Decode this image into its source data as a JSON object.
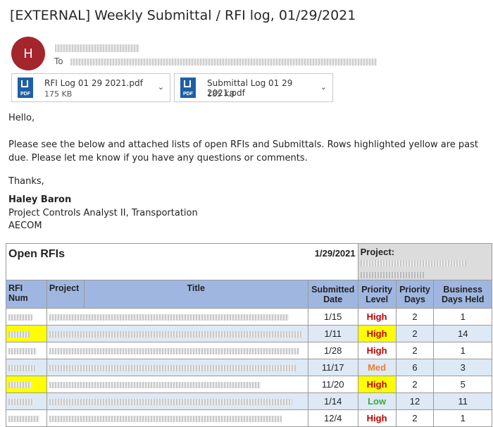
{
  "email": {
    "subject": "[EXTERNAL] Weekly Submittal / RFI log, 01/29/2021",
    "avatar_initial": "H",
    "to_label": "To",
    "attachments": [
      {
        "name": "RFI Log 01 29 2021.pdf",
        "size": "175 KB",
        "icon": "pdf-file-icon"
      },
      {
        "name": "Submittal Log 01 29 2021.pdf",
        "size": "185 KB",
        "icon": "pdf-file-icon"
      }
    ],
    "greeting": "Hello,",
    "paragraph": "Please see the below and attached lists of open RFIs and Submittals. Rows highlighted yellow are past due. Please let me know if you have any questions or comments.",
    "closing": "Thanks,",
    "signature": {
      "name": "Haley Baron",
      "title": "Project Controls Analyst II, Transportation",
      "company": "AECOM"
    }
  },
  "table": {
    "title": "Open RFIs",
    "date": "1/29/2021",
    "project_label": "Project:",
    "columns": [
      "RFI Num",
      "Project",
      "Title",
      "Submitted Date",
      "Priority Level",
      "Priority Days",
      "Business Days Held"
    ],
    "rows": [
      {
        "submitted": "1/15",
        "priority": "High",
        "days": "2",
        "held": "1",
        "past_due": false
      },
      {
        "submitted": "1/11",
        "priority": "High",
        "days": "2",
        "held": "14",
        "past_due": true
      },
      {
        "submitted": "1/28",
        "priority": "High",
        "days": "2",
        "held": "1",
        "past_due": false
      },
      {
        "submitted": "11/17",
        "priority": "Med",
        "days": "6",
        "held": "3",
        "past_due": false
      },
      {
        "submitted": "11/20",
        "priority": "High",
        "days": "2",
        "held": "5",
        "past_due": true
      },
      {
        "submitted": "1/14",
        "priority": "Low",
        "days": "12",
        "held": "11",
        "past_due": false
      },
      {
        "submitted": "12/4",
        "priority": "High",
        "days": "2",
        "held": "1",
        "past_due": false
      }
    ]
  },
  "colors": {
    "avatar": "#a4262c",
    "header_fill": "#9fb7e0",
    "alt_row": "#dde9f5",
    "past_due": "#ffff00",
    "high": "#c00000",
    "med": "#ed7d31",
    "low": "#3aaa35"
  }
}
